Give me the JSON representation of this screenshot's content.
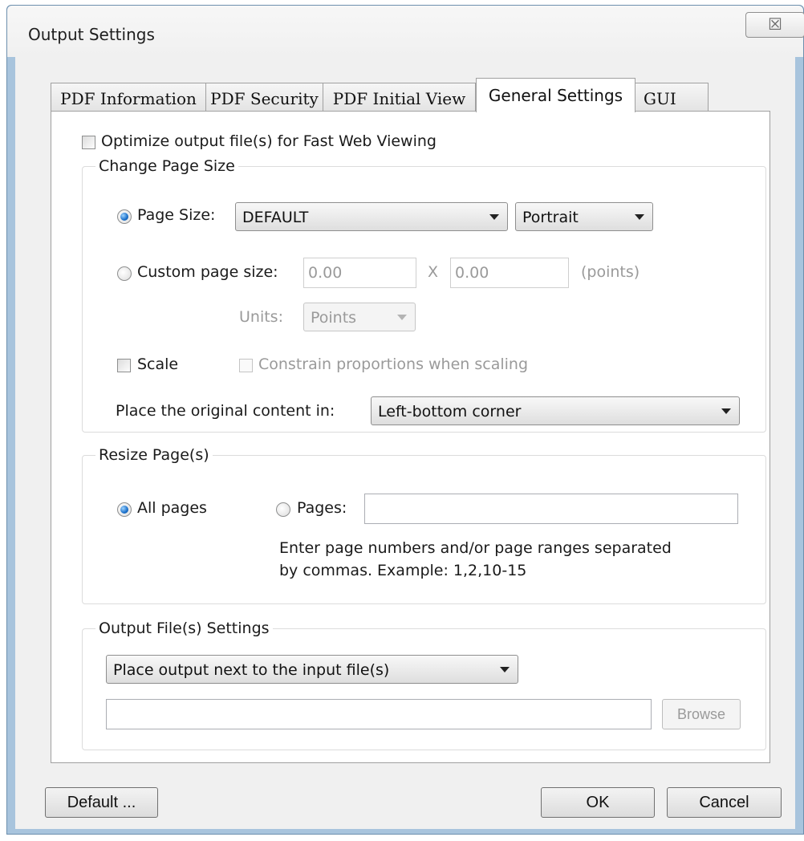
{
  "window": {
    "title": "Output Settings",
    "close_glyph": "☒"
  },
  "tabs": [
    {
      "label": "PDF Information",
      "active": false
    },
    {
      "label": "PDF Security",
      "active": false
    },
    {
      "label": "PDF Initial View",
      "active": false
    },
    {
      "label": "General Settings",
      "active": true
    },
    {
      "label": "GUI",
      "active": false
    }
  ],
  "optimize": {
    "label": "Optimize output file(s) for Fast Web Viewing",
    "checked": false
  },
  "change_page_size": {
    "legend": "Change Page Size",
    "page_size_label": "Page Size:",
    "page_size_selected": true,
    "page_size_value": "DEFAULT",
    "orientation_value": "Portrait",
    "custom_label": "Custom page size:",
    "custom_width": "0.00",
    "custom_x": "X",
    "custom_height": "0.00",
    "custom_unit_hint": "(points)",
    "units_label": "Units:",
    "units_value": "Points",
    "scale_label": "Scale",
    "scale_checked": false,
    "constrain_label": "Constrain proportions when scaling",
    "place_label": "Place the original content in:",
    "place_value": "Left-bottom corner"
  },
  "resize_pages": {
    "legend": "Resize Page(s)",
    "all_pages_label": "All pages",
    "all_pages_selected": true,
    "pages_label": "Pages:",
    "pages_value": "",
    "hint_line1": "Enter page numbers and/or page ranges separated",
    "hint_line2": "by commas. Example: 1,2,10-15"
  },
  "output_files": {
    "legend": "Output File(s) Settings",
    "location_value": "Place output next to the input file(s)",
    "path_value": "",
    "browse_label": "Browse"
  },
  "footer": {
    "default_label": "Default ...",
    "ok_label": "OK",
    "cancel_label": "Cancel"
  }
}
